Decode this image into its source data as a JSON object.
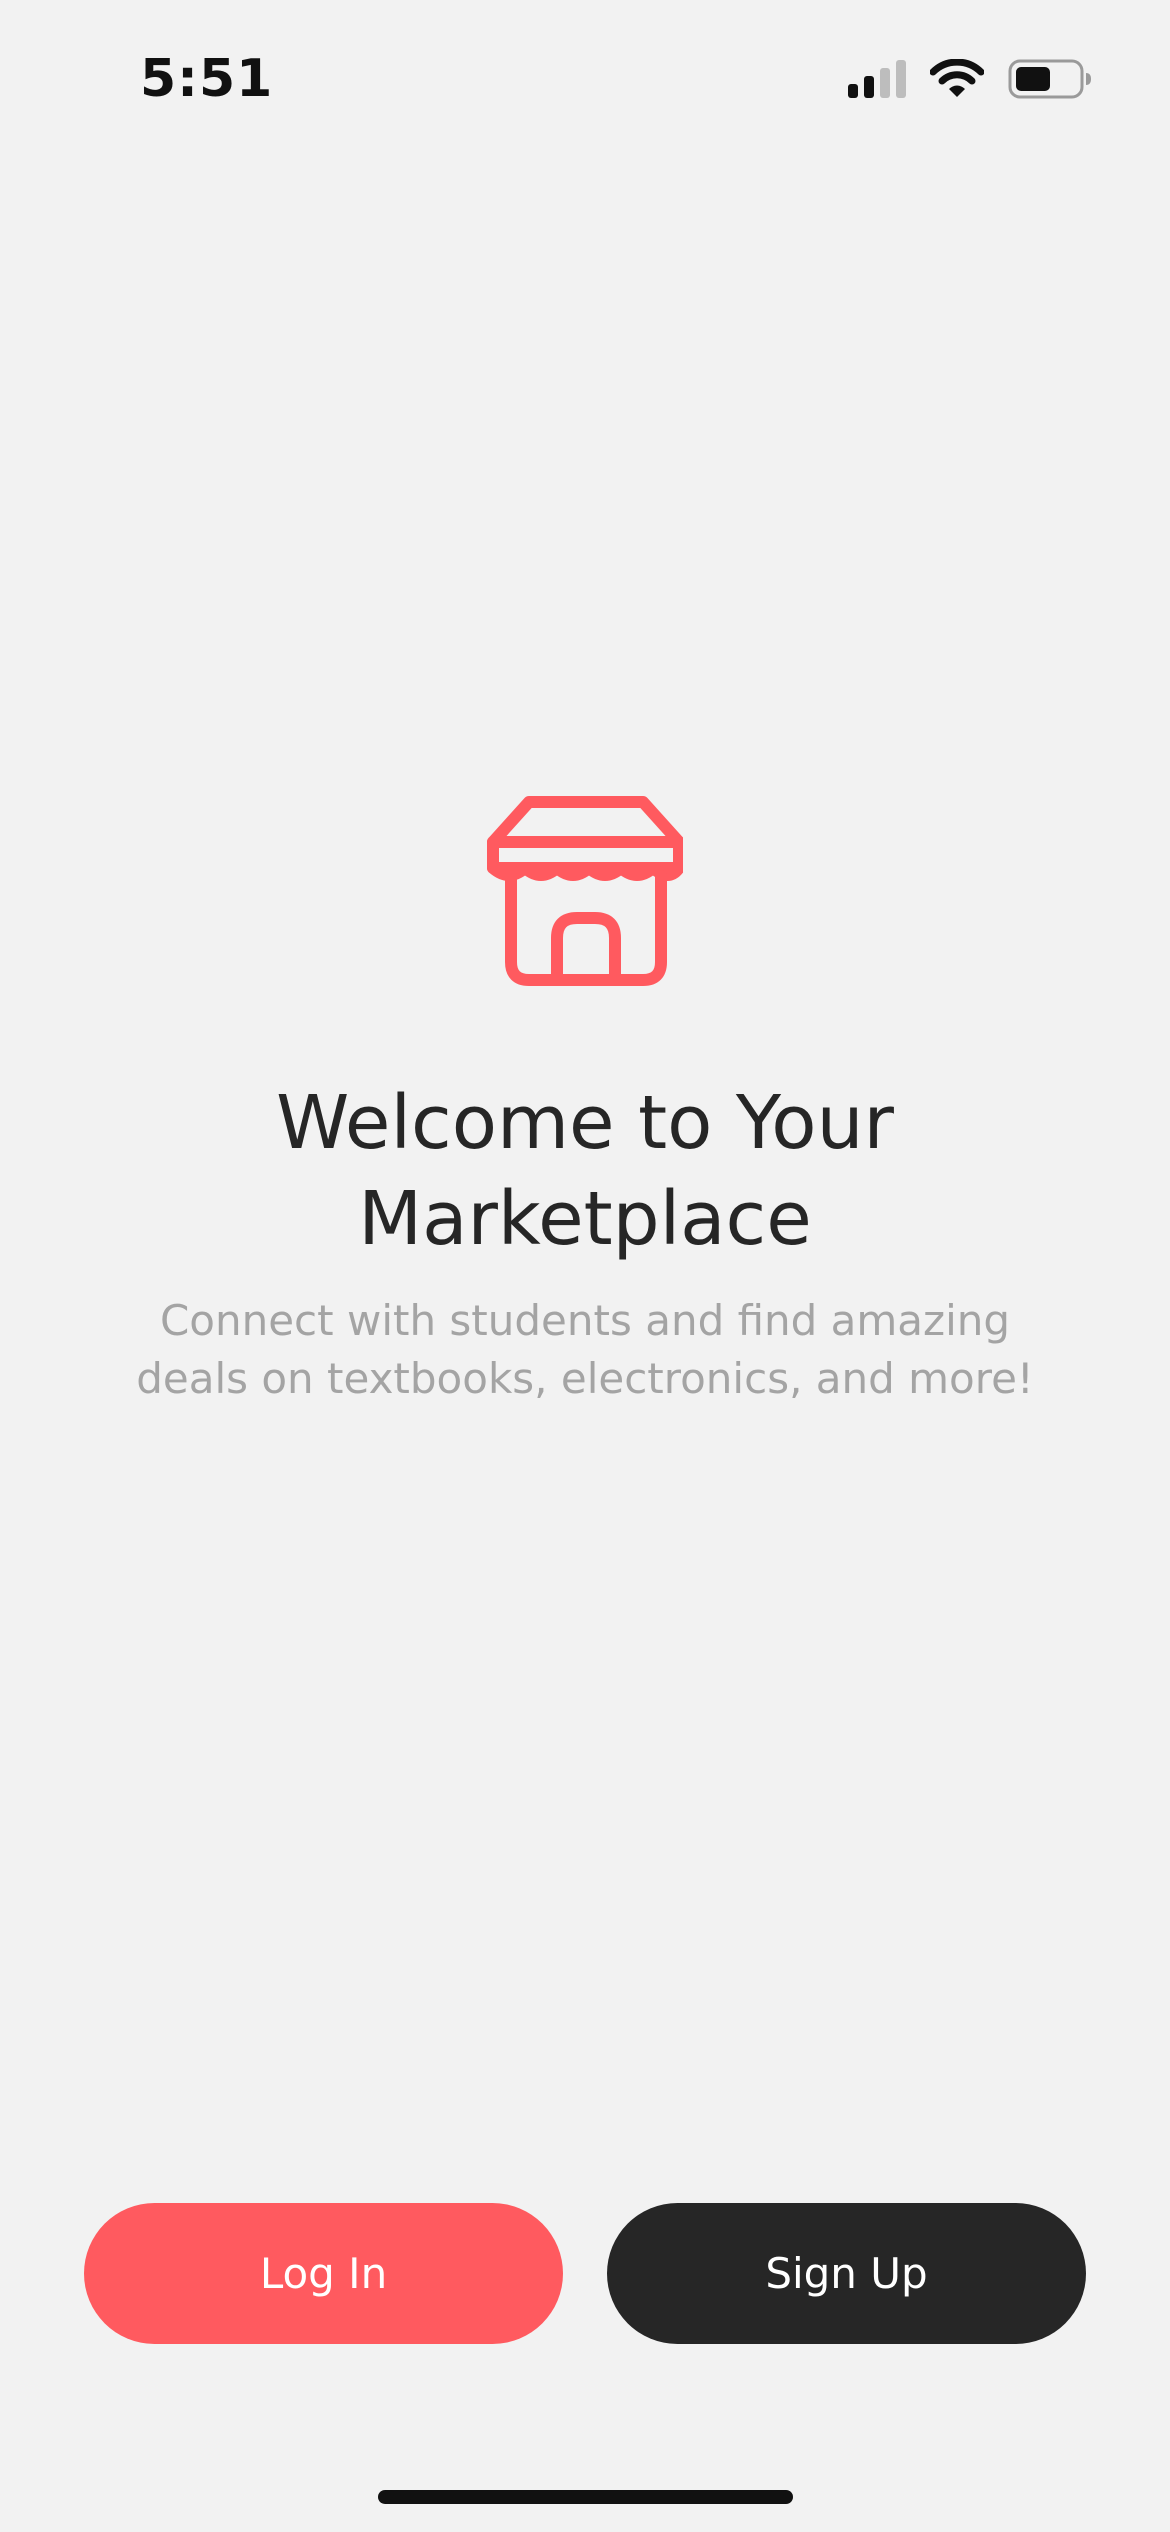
{
  "status_bar": {
    "time": "5:51",
    "icons": [
      "cellular-signal-icon",
      "wifi-icon",
      "battery-icon"
    ]
  },
  "hero": {
    "icon": "storefront-icon",
    "title": "Welcome to Your Marketplace",
    "subtitle": "Connect with students and find amazing deals on textbooks, electronics, and more!"
  },
  "actions": {
    "login_label": "Log In",
    "signup_label": "Sign Up"
  },
  "colors": {
    "background": "#f2f2f2",
    "accent": "#ff5a5f",
    "dark": "#262626",
    "muted_text": "#a4a4a4"
  }
}
